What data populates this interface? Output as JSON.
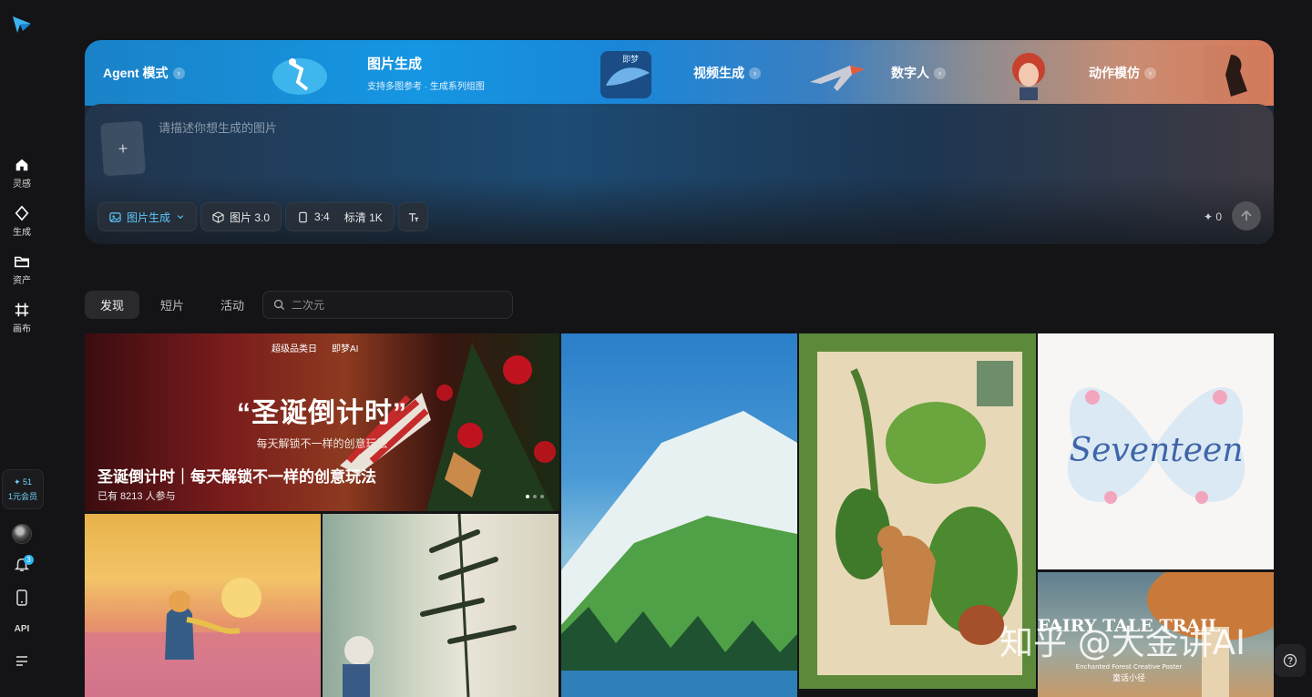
{
  "sidebar": {
    "items": [
      {
        "label": "灵感",
        "icon": "home-icon"
      },
      {
        "label": "生成",
        "icon": "sparkle-icon"
      },
      {
        "label": "资产",
        "icon": "folder-icon"
      },
      {
        "label": "画布",
        "icon": "canvas-icon"
      }
    ],
    "member": {
      "credits": "✦ 51",
      "label": "1元会员"
    },
    "notification_count": "3",
    "api_label": "API"
  },
  "modes": [
    {
      "label": "Agent 模式",
      "subtitle": ""
    },
    {
      "label": "图片生成",
      "subtitle": "支持多图参考 · 生成系列组图"
    },
    {
      "label": "视频生成",
      "subtitle": ""
    },
    {
      "label": "数字人",
      "subtitle": ""
    },
    {
      "label": "动作模仿",
      "subtitle": ""
    }
  ],
  "prompt": {
    "placeholder": "请描述你想生成的图片",
    "add_symbol": "+"
  },
  "toolbar": {
    "mode_chip": "图片生成",
    "model_chip": "图片 3.0",
    "ratio": "3:4",
    "quality": "标清 1K",
    "credits": "✦ 0"
  },
  "tabs": [
    {
      "label": "发现",
      "active": true
    },
    {
      "label": "短片",
      "active": false
    },
    {
      "label": "活动",
      "active": false
    }
  ],
  "search": {
    "placeholder": "二次元"
  },
  "banner": {
    "brand_left": "超级品类日",
    "brand_right": "即梦AI",
    "headline": "“圣诞倒计时”",
    "subline": "每天解锁不一样的创意玩法",
    "caption": "圣诞倒计时｜每天解锁不一样的创意玩法",
    "participants": "已有 8213 人参与"
  },
  "gallery_text": {
    "seventeen": "Seventeen",
    "fairy_title": "FAIRY TALE TRAIL",
    "fairy_sub": "Enchanted Forest Creative Poster",
    "fairy_cn": "童话小径"
  },
  "watermark": "知乎 @大金讲AI",
  "colors": {
    "accent": "#5bc8ff",
    "background": "#141416",
    "badge": "#2db7f5"
  }
}
